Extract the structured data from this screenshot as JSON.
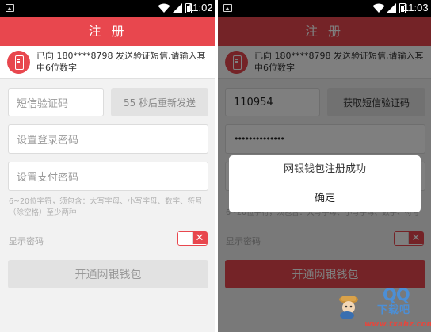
{
  "colors": {
    "accent": "#e8474e",
    "background": "#f2f2f2",
    "field_bg": "#ffffff",
    "button_disabled": "#e2e2e2",
    "url_red": "#e2483f",
    "logo_blue": "#4c8fd6"
  },
  "left": {
    "status_time": "11:02",
    "title": "注 册",
    "info_text": "已向 180****8798 发送验证短信,请输入其中6位数字",
    "sms_code_placeholder": "短信验证码",
    "resend_label": "55 秒后重新发送",
    "login_pwd_placeholder": "设置登录密码",
    "pay_pwd_placeholder": "设置支付密码",
    "password_hint": "6~20位字符，须包含：大写字母、小写字母、数字、符号（除空格）至少两种",
    "show_password_label": "显示密码",
    "show_password_toggle_icon": "close-x-icon",
    "submit_label": "开通网银钱包",
    "submit_enabled": false
  },
  "right": {
    "status_time": "11:03",
    "title": "注 册",
    "info_text": "已向 180****8798 发送验证短信,请输入其中6位数字",
    "sms_code_value": "110954",
    "get_code_label": "获取短信验证码",
    "login_pwd_masked": "••••••••••••••",
    "password_hint_partial": "6~20位字符，须包含：大写字母、小写字母、数字、符号（除空格）至少两种",
    "show_password_label": "显示密码",
    "submit_label": "开通网银钱包",
    "submit_enabled": true,
    "dialog": {
      "message": "网银钱包注册成功",
      "ok_label": "确定"
    }
  },
  "watermark": {
    "qq": "QQ",
    "name": "下载吧",
    "url": "www.txahz.com"
  }
}
